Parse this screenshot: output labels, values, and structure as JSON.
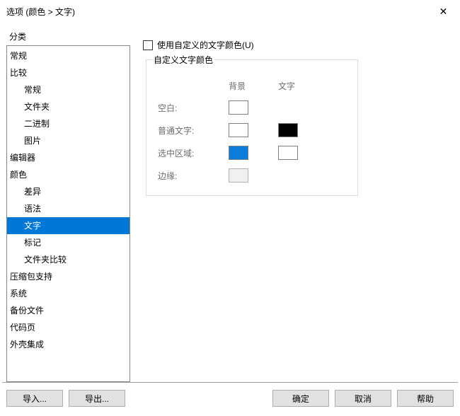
{
  "window": {
    "title": "选项 (颜色 > 文字)"
  },
  "sidebar": {
    "label": "分类",
    "items": [
      {
        "label": "常规",
        "depth": 0,
        "selected": false
      },
      {
        "label": "比较",
        "depth": 0,
        "selected": false
      },
      {
        "label": "常规",
        "depth": 1,
        "selected": false
      },
      {
        "label": "文件夹",
        "depth": 1,
        "selected": false
      },
      {
        "label": "二进制",
        "depth": 1,
        "selected": false
      },
      {
        "label": "图片",
        "depth": 1,
        "selected": false
      },
      {
        "label": "编辑器",
        "depth": 0,
        "selected": false
      },
      {
        "label": "颜色",
        "depth": 0,
        "selected": false
      },
      {
        "label": "差异",
        "depth": 1,
        "selected": false
      },
      {
        "label": "语法",
        "depth": 1,
        "selected": false
      },
      {
        "label": "文字",
        "depth": 1,
        "selected": true
      },
      {
        "label": "标记",
        "depth": 1,
        "selected": false
      },
      {
        "label": "文件夹比较",
        "depth": 1,
        "selected": false
      },
      {
        "label": "压缩包支持",
        "depth": 0,
        "selected": false
      },
      {
        "label": "系统",
        "depth": 0,
        "selected": false
      },
      {
        "label": "备份文件",
        "depth": 0,
        "selected": false
      },
      {
        "label": "代码页",
        "depth": 0,
        "selected": false
      },
      {
        "label": "外壳集成",
        "depth": 0,
        "selected": false
      }
    ]
  },
  "main": {
    "checkbox_label": "使用自定义的文字颜色(U)",
    "checkbox_checked": false,
    "fieldset_title": "自定义文字颜色",
    "headers": {
      "bg": "背景",
      "fg": "文字"
    },
    "rows": [
      {
        "label": "空白:",
        "bg": "white",
        "fg": null
      },
      {
        "label": "普通文字:",
        "bg": "white",
        "fg": "black"
      },
      {
        "label": "选中区域:",
        "bg": "blue",
        "fg": "white"
      },
      {
        "label": "边缘:",
        "bg": "none",
        "fg": null
      }
    ]
  },
  "footer": {
    "import": "导入...",
    "export": "导出...",
    "ok": "确定",
    "cancel": "取消",
    "help": "帮助"
  }
}
